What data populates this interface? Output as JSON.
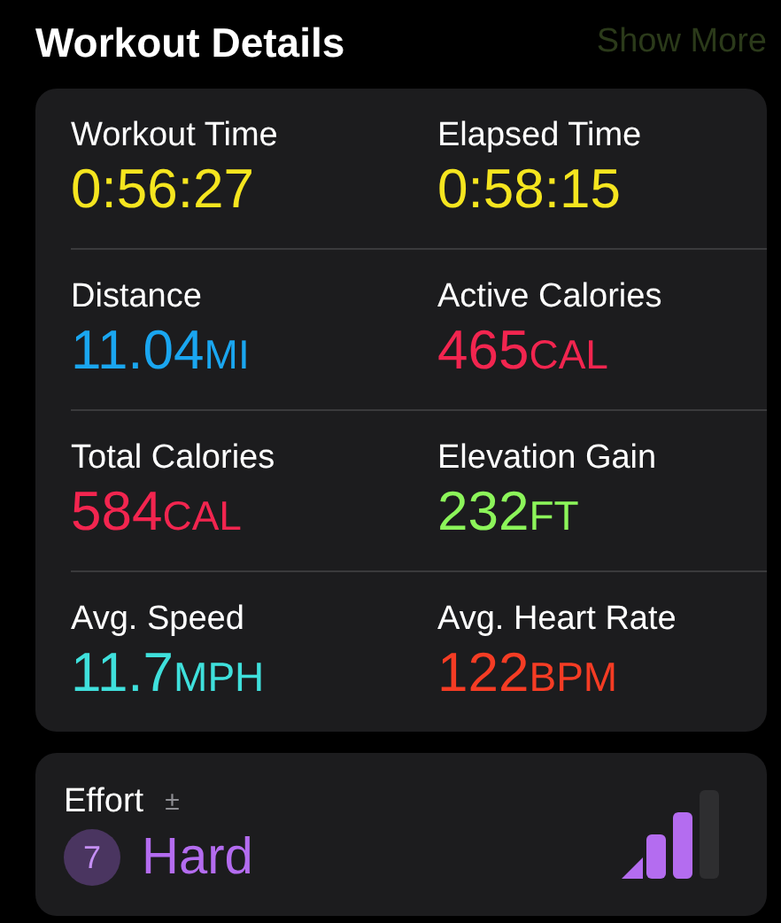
{
  "header": {
    "title": "Workout Details",
    "action": "Show More"
  },
  "metrics": [
    {
      "label": "Workout Time",
      "value": "0:56:27",
      "color": "#f5e51f"
    },
    {
      "label": "Elapsed Time",
      "value": "0:58:15",
      "color": "#f5e51f"
    },
    {
      "label": "Distance",
      "value": "11.04",
      "unit": "MI",
      "color": "#1aa6f0"
    },
    {
      "label": "Active Calories",
      "value": "465",
      "unit": "CAL",
      "color": "#f2254f"
    },
    {
      "label": "Total Calories",
      "value": "584",
      "unit": "CAL",
      "color": "#f2254f"
    },
    {
      "label": "Elevation Gain",
      "value": "232",
      "unit": "FT",
      "color": "#8cf55a"
    },
    {
      "label": "Avg. Speed",
      "value": "11.7",
      "unit": "MPH",
      "color": "#3fe0dc"
    },
    {
      "label": "Avg. Heart Rate",
      "value": "122",
      "unit": "BPM",
      "color": "#f53c24"
    }
  ],
  "effort": {
    "label": "Effort",
    "adjust": "±",
    "score": "7",
    "rating": "Hard",
    "bars": [
      {
        "filled": true
      },
      {
        "filled": true
      },
      {
        "filled": true
      },
      {
        "filled": false
      }
    ]
  }
}
